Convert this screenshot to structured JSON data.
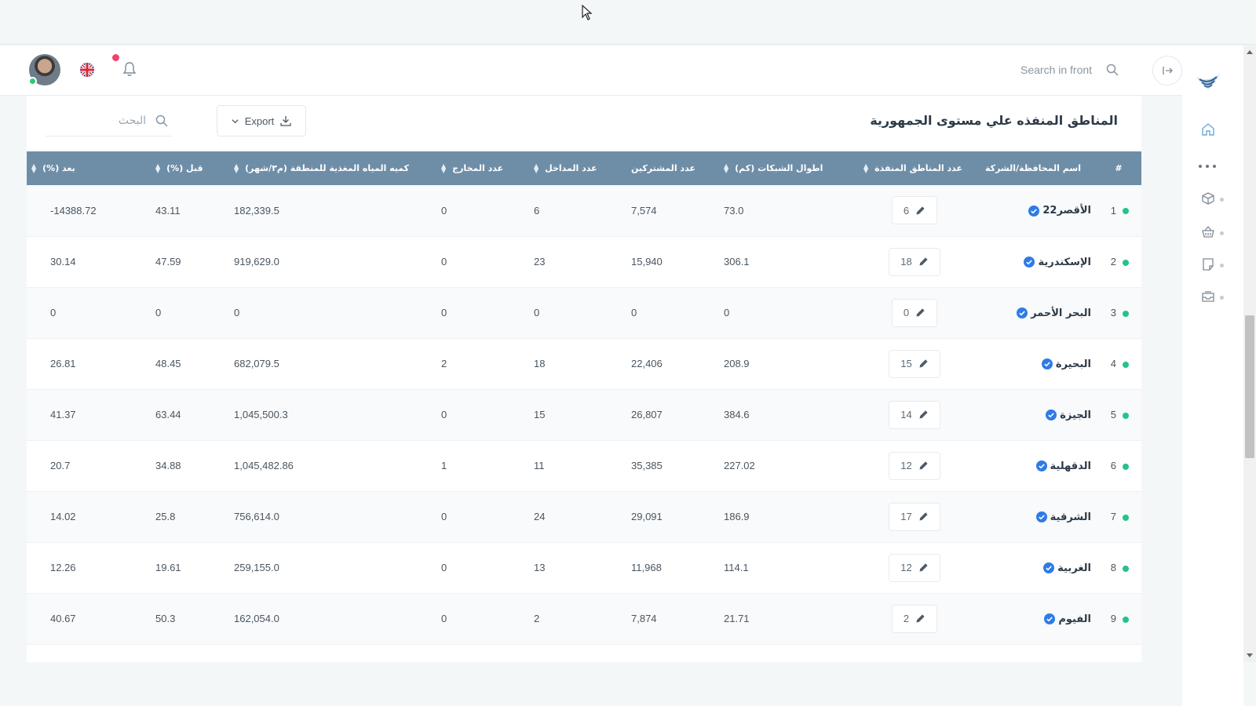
{
  "header": {
    "search_placeholder": "Search in front"
  },
  "card": {
    "title": "المناطق المنفذه علي مستوى الجمهورية",
    "export_label": "Export",
    "search_placeholder": "البحث"
  },
  "table": {
    "columns": {
      "index": "#",
      "name": "اسم المحافظة/الشركة",
      "zones": "عدد المناطق المنفذة",
      "network_length": "اطوال الشبكات (كم)",
      "subscribers": "عدد المشتركين",
      "inlets": "عدد المداخل",
      "outlets": "عدد المخارج",
      "water": "كميه المياه المغذية للمنطقة (م٣/شهر)",
      "before": "قبل (%)",
      "after": "بعد (%)"
    },
    "rows": [
      {
        "index": "1",
        "name": "الأقصر22",
        "zones": "6",
        "network_length": "73.0",
        "subscribers": "7,574",
        "inlets": "6",
        "outlets": "0",
        "water": "182,339.5",
        "before": "43.11",
        "after": "14388.72-"
      },
      {
        "index": "2",
        "name": "الإسكندرية",
        "zones": "18",
        "network_length": "306.1",
        "subscribers": "15,940",
        "inlets": "23",
        "outlets": "0",
        "water": "919,629.0",
        "before": "47.59",
        "after": "30.14"
      },
      {
        "index": "3",
        "name": "البحر الأحمر",
        "zones": "0",
        "network_length": "0",
        "subscribers": "0",
        "inlets": "0",
        "outlets": "0",
        "water": "0",
        "before": "0",
        "after": "0"
      },
      {
        "index": "4",
        "name": "البحيرة",
        "zones": "15",
        "network_length": "208.9",
        "subscribers": "22,406",
        "inlets": "18",
        "outlets": "2",
        "water": "682,079.5",
        "before": "48.45",
        "after": "26.81"
      },
      {
        "index": "5",
        "name": "الجيزة",
        "zones": "14",
        "network_length": "384.6",
        "subscribers": "26,807",
        "inlets": "15",
        "outlets": "0",
        "water": "1,045,500.3",
        "before": "63.44",
        "after": "41.37"
      },
      {
        "index": "6",
        "name": "الدقهلية",
        "zones": "12",
        "network_length": "227.02",
        "subscribers": "35,385",
        "inlets": "11",
        "outlets": "1",
        "water": "1,045,482.86",
        "before": "34.88",
        "after": "20.7"
      },
      {
        "index": "7",
        "name": "الشرقية",
        "zones": "17",
        "network_length": "186.9",
        "subscribers": "29,091",
        "inlets": "24",
        "outlets": "0",
        "water": "756,614.0",
        "before": "25.8",
        "after": "14.02"
      },
      {
        "index": "8",
        "name": "الغربية",
        "zones": "12",
        "network_length": "114.1",
        "subscribers": "11,968",
        "inlets": "13",
        "outlets": "0",
        "water": "259,155.0",
        "before": "19.61",
        "after": "12.26"
      },
      {
        "index": "9",
        "name": "الفيوم",
        "zones": "2",
        "network_length": "21.71",
        "subscribers": "7,874",
        "inlets": "2",
        "outlets": "0",
        "water": "162,054.0",
        "before": "50.3",
        "after": "40.67"
      }
    ]
  },
  "colors": {
    "header_bg": "#6e8ea8",
    "status_dot": "#22c487",
    "verified": "#2f7be6",
    "notification_dot": "#f0436b"
  },
  "icons": {
    "logo": "bird-logo-icon",
    "home": "home-icon",
    "more": "more-dots-icon",
    "box": "box-icon",
    "basket": "basket-icon",
    "notes": "notes-icon",
    "inbox": "inbox-icon",
    "search": "search-icon",
    "bell": "bell-icon",
    "flag": "uk-flag-icon",
    "collapse": "collapse-arrow-icon",
    "edit": "pencil-icon",
    "verified": "verified-badge-icon",
    "download": "download-icon"
  }
}
